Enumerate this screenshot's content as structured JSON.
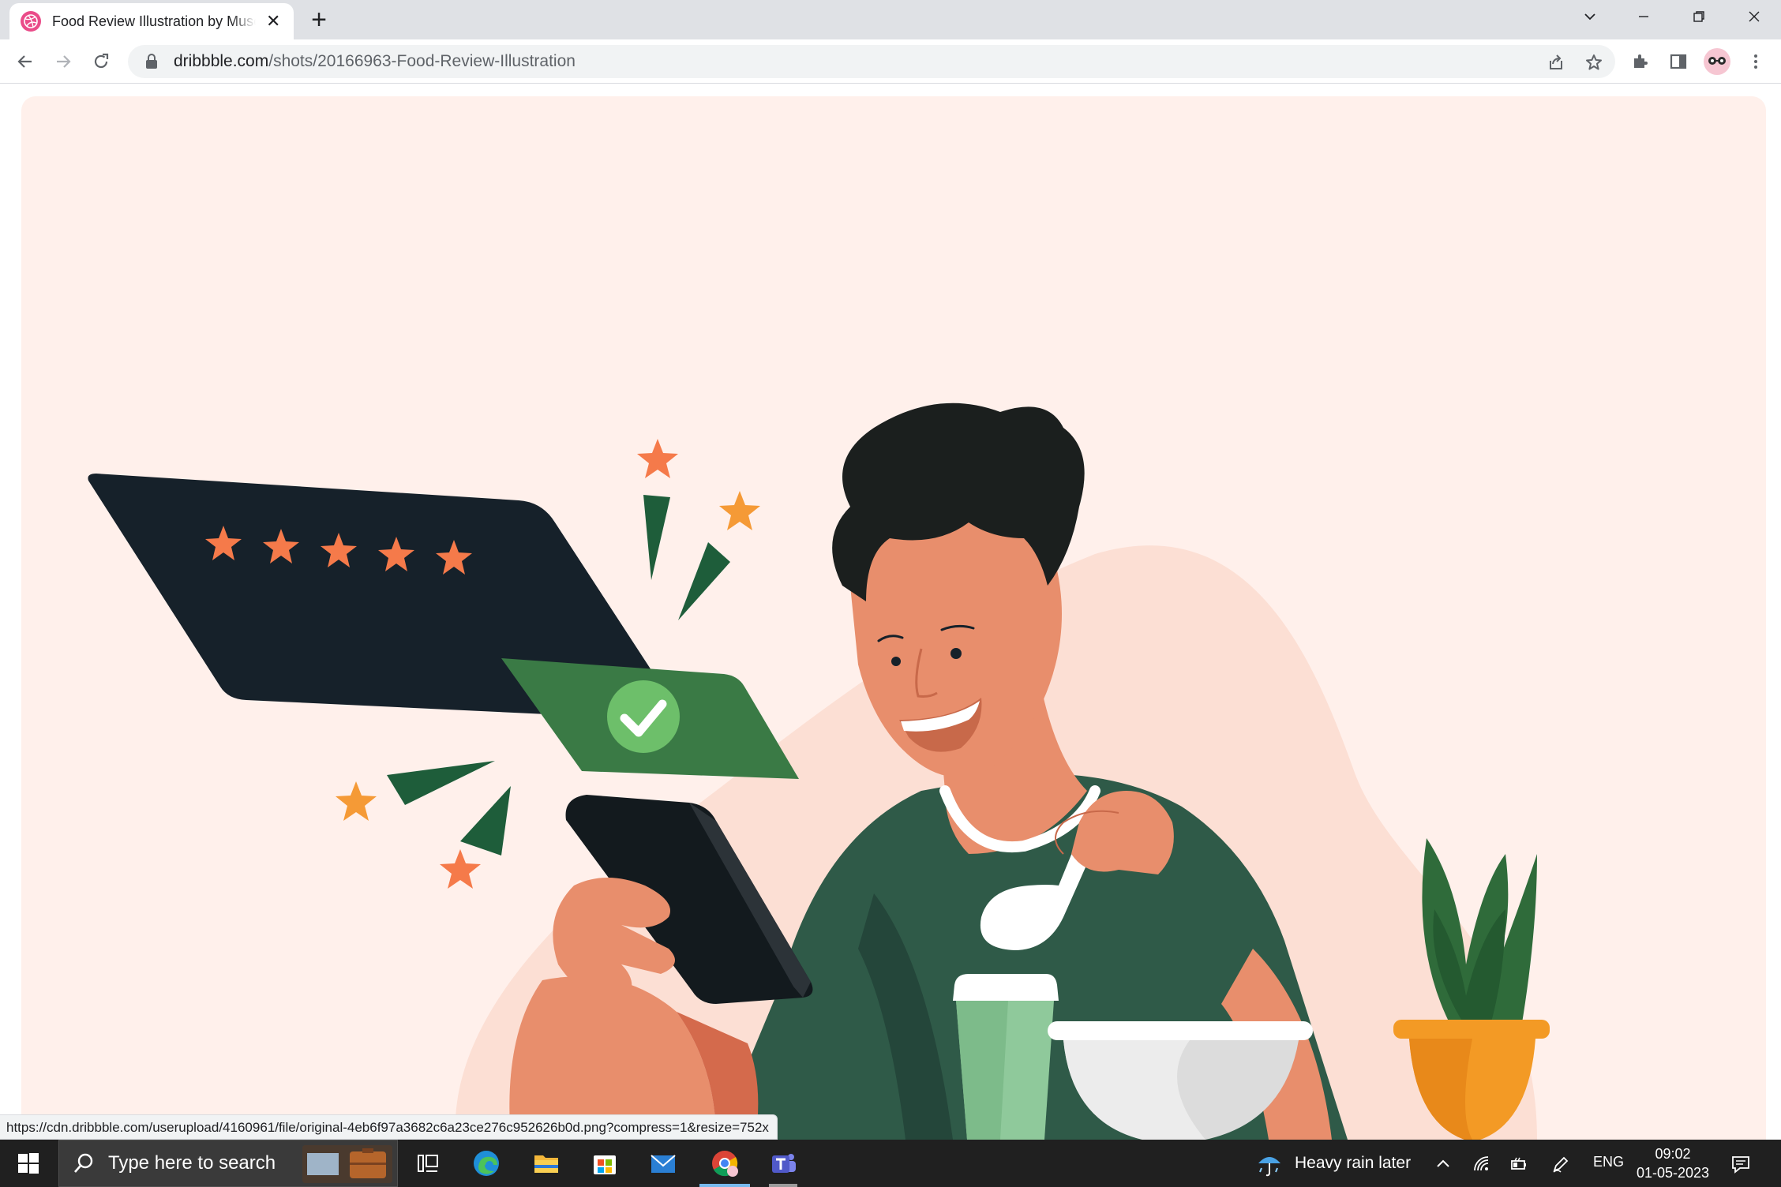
{
  "browser": {
    "tab": {
      "title": "Food Review Illustration by Muse",
      "favicon": "dribbble-icon",
      "close_glyph": "✕"
    },
    "new_tab_glyph": "+",
    "address": {
      "host": "dribbble.com",
      "path": "/shots/20166963-Food-Review-Illustration"
    },
    "status_url": "https://cdn.dribbble.com/userupload/4160961/file/original-4eb6f97a3682c6a23ce276c952626b0d.png?compress=1&resize=752x"
  },
  "illustration": {
    "subject": "Man rating food on tablet",
    "rating_stars": 5,
    "colors": {
      "background": "#fff0eb",
      "blob": "#fcdfd4",
      "dark_card": "#16212a",
      "green_card": "#3a7a45",
      "check_circle": "#6dbf6a",
      "skin": "#e88e6c",
      "skin_shadow": "#d46a4c",
      "shirt": "#2f5a48",
      "hair": "#1b1f1e",
      "star": "#f57a4a",
      "star_alt": "#f59a36",
      "pot": "#f39a25",
      "plant": "#2f6b3a"
    }
  },
  "taskbar": {
    "search_placeholder": "Type here to search",
    "weather": "Heavy rain later",
    "language": "ENG",
    "time": "09:02",
    "date": "01-05-2023",
    "apps": [
      "task-view-icon",
      "edge-icon",
      "file-explorer-icon",
      "microsoft-store-icon",
      "mail-icon",
      "chrome-icon",
      "teams-icon"
    ]
  }
}
